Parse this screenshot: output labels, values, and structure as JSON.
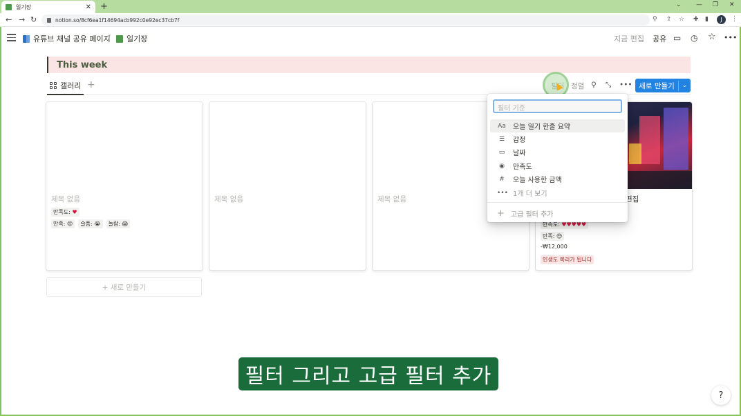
{
  "browser": {
    "tab_title": "일기장",
    "new_tab": "+",
    "url": "notion.so/8cf6ea1f14694acb992c0e92ec37cb7f",
    "profile_initial": "J"
  },
  "topbar": {
    "breadcrumb": [
      {
        "label": "유튜브 채널 공유 페이지"
      },
      {
        "label": "일기장"
      }
    ],
    "separator": "/",
    "edit_label": "지금 편집",
    "share_label": "공유"
  },
  "page": {
    "callout_text": "This week"
  },
  "viewbar": {
    "view_label": "갤러리",
    "add_view": "+",
    "filter_label": "필터",
    "sort_label": "정렬",
    "more": "•••",
    "new_label": "새로 만들기"
  },
  "cards": [
    {
      "title": "제목 없음",
      "satisfaction_label": "만족도:",
      "emotions": [
        {
          "label": "만족:",
          "emoji": "😍"
        },
        {
          "label": "슬픔:",
          "emoji": "😭"
        },
        {
          "label": "놀람:",
          "emoji": "😱"
        }
      ]
    },
    {
      "title": "제목 없음"
    },
    {
      "title": "제목 없음"
    },
    {
      "title_partial": "편집",
      "satisfaction_label": "만족도:",
      "emotion": {
        "label": "만족:",
        "emoji": "😍"
      },
      "amount": "-₩12,000",
      "summary_tag": "인생도 복리가 됩니다"
    }
  ],
  "new_card_label": "+ 새로 만들기",
  "filter_menu": {
    "placeholder": "필터 기준",
    "items": [
      {
        "icon": "Aa",
        "label": "오늘 일기 한줄 요약"
      },
      {
        "icon": "☰",
        "label": "감정"
      },
      {
        "icon": "▭",
        "label": "날짜"
      },
      {
        "icon": "◉",
        "label": "만족도"
      },
      {
        "icon": "#",
        "label": "오늘 사용한 금액"
      },
      {
        "icon": "•••",
        "label": "1개 더 보기"
      }
    ],
    "advanced_label": "고급 필터 추가"
  },
  "subtitle": "필터 그리고 고급 필터 추가",
  "help": "?",
  "colors": {
    "accent": "#2383e2",
    "callout_bg": "#fbe4e4",
    "subtitle_bg": "#1a6d3b",
    "tab_strip": "#b7dca0"
  }
}
